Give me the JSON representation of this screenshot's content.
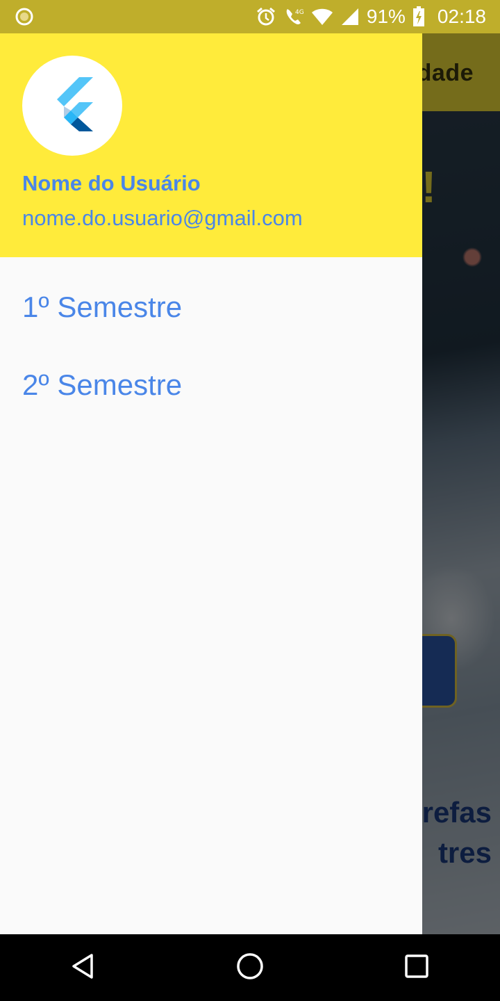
{
  "status_bar": {
    "battery": "91%",
    "time": "02:18",
    "icons": [
      "notification-dot-icon",
      "alarm-icon",
      "wifi-calling-icon",
      "wifi-icon",
      "cell-signal-icon",
      "battery-charging-icon"
    ]
  },
  "app": {
    "title_fragment": "dade",
    "hero_fragment": "!",
    "bottom_text_line1": "refas",
    "bottom_text_line2": "tres"
  },
  "drawer": {
    "account_name": "Nome do Usuário",
    "account_email": "nome.do.usuario@gmail.com",
    "avatar_icon": "flutter-logo-icon",
    "items": [
      {
        "label": "1º Semestre"
      },
      {
        "label": "2º Semestre"
      }
    ]
  },
  "nav_bar": {
    "buttons": [
      "back-icon",
      "home-icon",
      "recents-icon"
    ]
  },
  "colors": {
    "accent_yellow": "#ffeb3b",
    "link_blue": "#4a86e8",
    "status_bar": "#bfae2b"
  }
}
